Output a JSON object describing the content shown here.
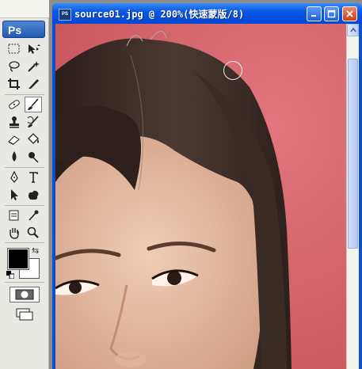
{
  "toolbox": {
    "logo_label": "Ps",
    "tools": [
      {
        "name": "rectangular-marquee-icon"
      },
      {
        "name": "move-icon"
      },
      {
        "name": "lasso-icon"
      },
      {
        "name": "magic-wand-icon"
      },
      {
        "name": "crop-icon"
      },
      {
        "name": "slice-icon"
      },
      {
        "name": "healing-brush-icon"
      },
      {
        "name": "brush-icon",
        "active": true
      },
      {
        "name": "clone-stamp-icon"
      },
      {
        "name": "history-brush-icon"
      },
      {
        "name": "eraser-icon"
      },
      {
        "name": "paint-bucket-icon"
      },
      {
        "name": "blur-icon"
      },
      {
        "name": "dodge-icon"
      },
      {
        "name": "pen-icon"
      },
      {
        "name": "type-icon"
      },
      {
        "name": "path-selection-icon"
      },
      {
        "name": "custom-shape-icon"
      },
      {
        "name": "notes-icon"
      },
      {
        "name": "eyedropper-icon"
      },
      {
        "name": "hand-icon"
      },
      {
        "name": "zoom-icon"
      }
    ],
    "foreground_color": "#000000",
    "background_color": "#ffffff"
  },
  "document": {
    "title": "source01.jpg @ 200%(快速蒙版/8)",
    "icon_label": "PS",
    "quick_mask_tint": "#d9656d"
  }
}
